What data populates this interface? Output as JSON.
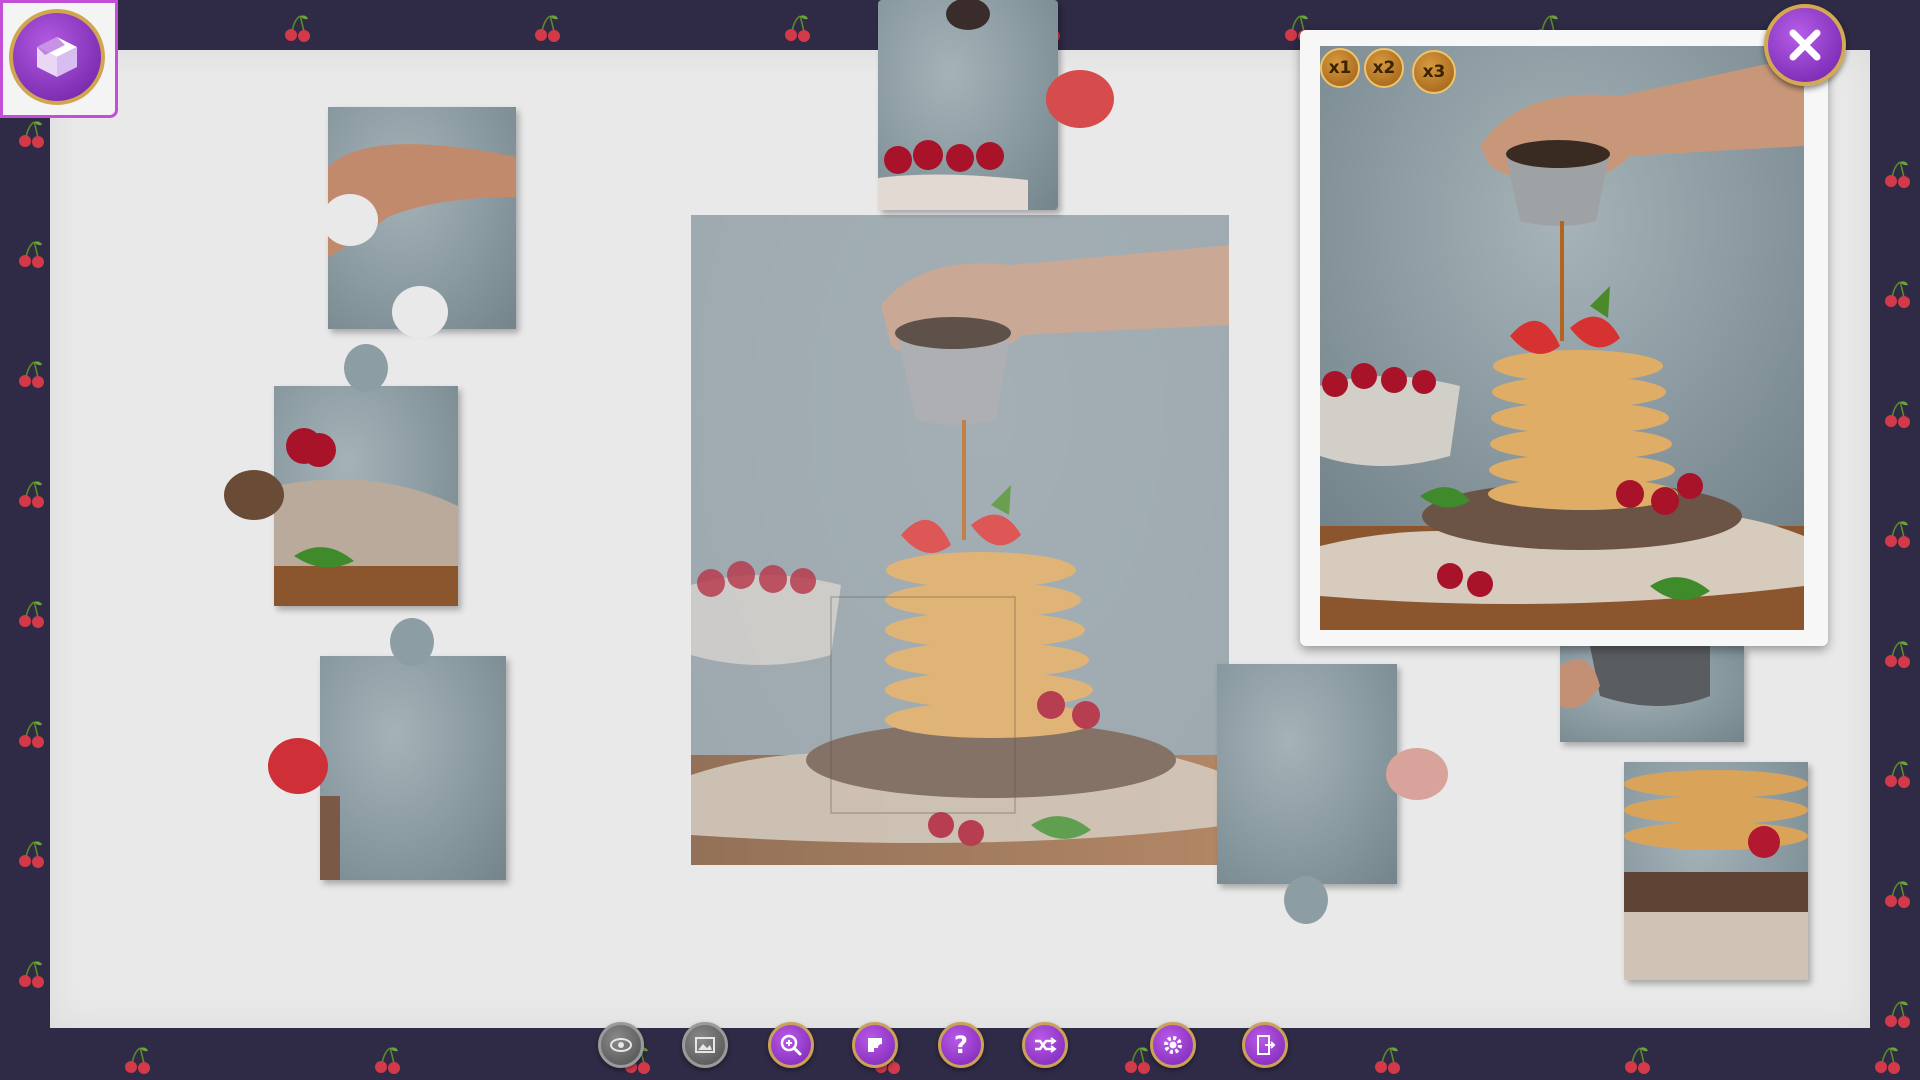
{
  "game": {
    "board_color": "#e9e9ea",
    "background_color": "#2f2a45",
    "accent_purple": "#8a2fc4",
    "accent_gold": "#d1a650"
  },
  "top_left": {
    "icon": "box-icon"
  },
  "preview": {
    "multipliers": [
      "x1",
      "x2",
      "x3"
    ],
    "close_icon": "close-icon"
  },
  "toolbar": [
    {
      "name": "eye-icon",
      "style": "gray"
    },
    {
      "name": "image-icon",
      "style": "gray"
    },
    {
      "name": "zoom-icon",
      "style": "purple"
    },
    {
      "name": "edges-icon",
      "style": "purple"
    },
    {
      "name": "help-icon",
      "style": "purple",
      "label": "?"
    },
    {
      "name": "shuffle-icon",
      "style": "purple"
    },
    {
      "name": "settings-icon",
      "style": "purple"
    },
    {
      "name": "exit-icon",
      "style": "purple"
    }
  ]
}
